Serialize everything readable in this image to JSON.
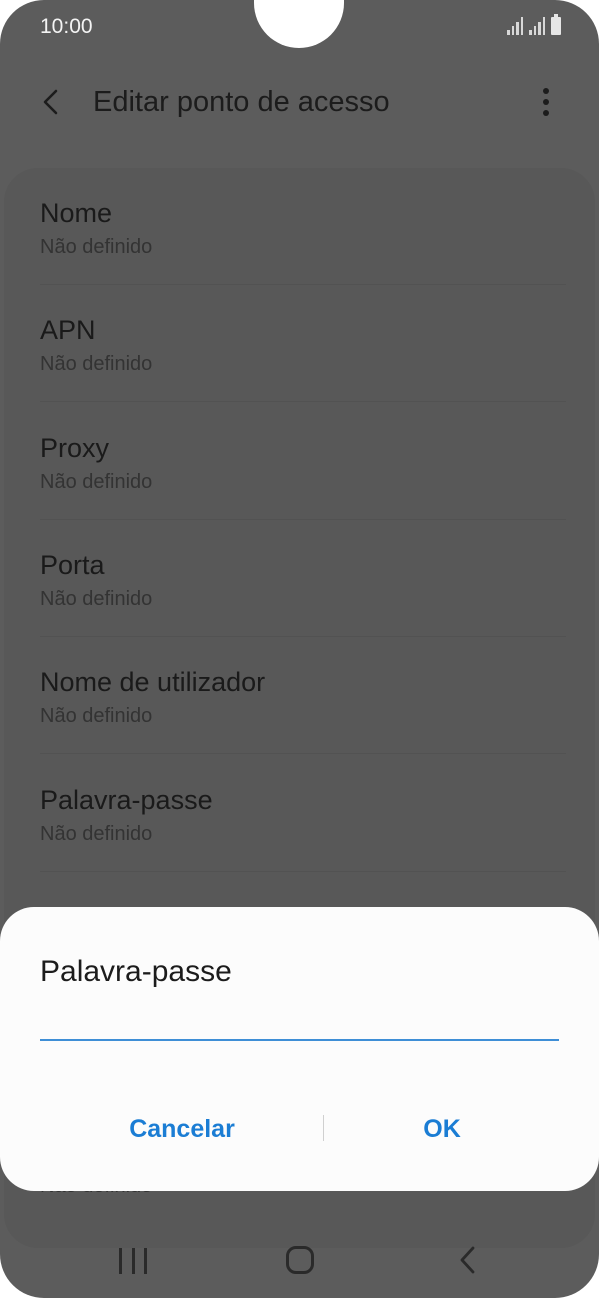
{
  "status_bar": {
    "time": "10:00",
    "icons": [
      "signal-icon",
      "signal-icon",
      "battery-icon"
    ]
  },
  "app_bar": {
    "title": "Editar ponto de acesso",
    "back_icon": "back-arrow-icon",
    "more_icon": "more-vert-icon"
  },
  "settings": {
    "items": [
      {
        "title": "Nome",
        "value": "Não definido"
      },
      {
        "title": "APN",
        "value": "Não definido"
      },
      {
        "title": "Proxy",
        "value": "Não definido"
      },
      {
        "title": "Porta",
        "value": "Não definido"
      },
      {
        "title": "Nome de utilizador",
        "value": "Não definido"
      },
      {
        "title": "Palavra-passe",
        "value": "Não definido"
      }
    ],
    "partially_hidden_value": "Não definido"
  },
  "dialog": {
    "title": "Palavra-passe",
    "input_value": "",
    "cancel_label": "Cancelar",
    "ok_label": "OK",
    "accent_color": "#1b7dd4"
  },
  "nav_bar": {
    "icons": [
      "recent-apps-icon",
      "home-icon",
      "back-icon"
    ]
  }
}
